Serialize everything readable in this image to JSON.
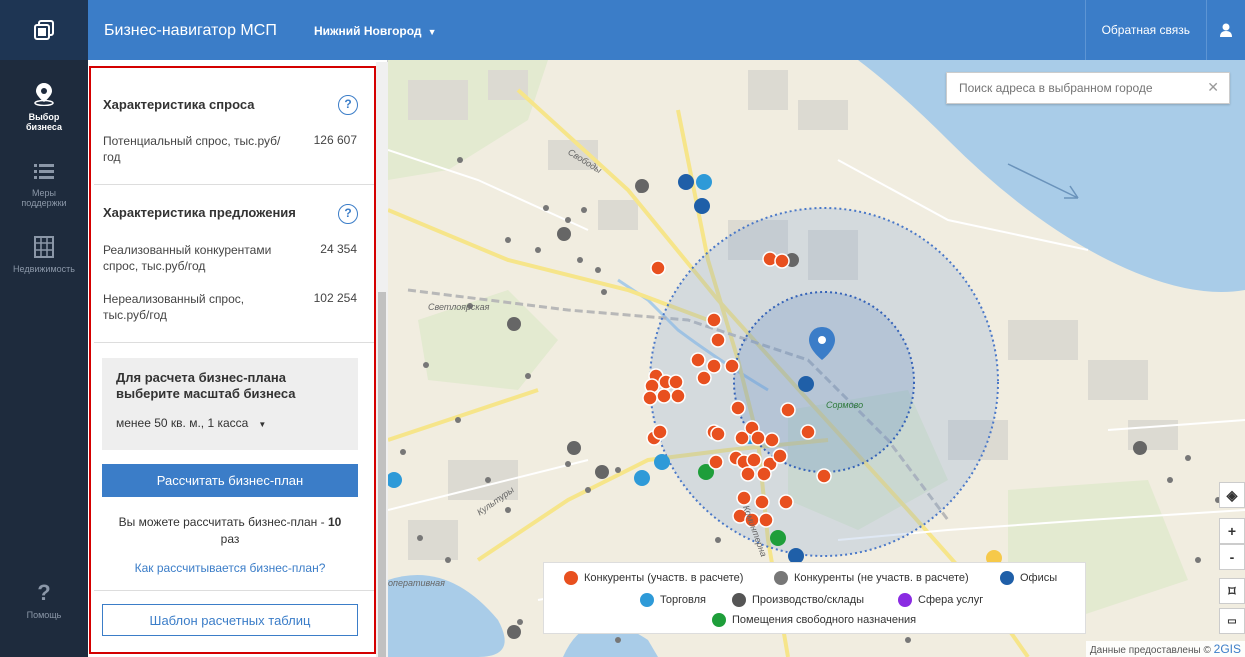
{
  "header": {
    "app_title": "Бизнес-навигатор МСП",
    "city": "Нижний Новгород",
    "feedback": "Обратная связь"
  },
  "sidenav": {
    "items": [
      {
        "label_line1": "Выбор",
        "label_line2": "бизнеса",
        "icon": "map-pin-icon"
      },
      {
        "label_line1": "Меры",
        "label_line2": "поддержки",
        "icon": "list-icon"
      },
      {
        "label_line1": "Недвижимость",
        "label_line2": "",
        "icon": "building-icon"
      },
      {
        "label_line1": "Помощь",
        "label_line2": "",
        "icon": "question-icon"
      }
    ]
  },
  "panel": {
    "demand": {
      "title": "Характеристика спроса",
      "rows": [
        {
          "label": "Потенциальный спрос, тыс.руб/год",
          "value": "126 607"
        }
      ]
    },
    "supply": {
      "title": "Характеристика предложения",
      "rows": [
        {
          "label": "Реализованный конкурентами спрос, тыс.руб/год",
          "value": "24 354"
        },
        {
          "label": "Нереализованный спрос, тыс.руб/год",
          "value": "102 254"
        }
      ]
    },
    "scale": {
      "title": "Для расчета бизнес-плана выберите масштаб бизнеса",
      "selected": "менее 50 кв. м., 1 касса"
    },
    "calc_button": "Рассчитать бизнес-план",
    "calc_note_prefix": "Вы можете рассчитать бизнес-план - ",
    "calc_note_count": "10",
    "calc_note_suffix": "раз",
    "how_link": "Как рассчитывается бизнес-план?",
    "template_button": "Шаблон расчетных таблиц"
  },
  "map": {
    "search_placeholder": "Поиск адреса в выбранном городе",
    "streets": [
      "Свободы",
      "Светлоярская",
      "Сормово",
      "Культуры",
      "Коминтерна",
      "оперативная"
    ],
    "attribution": "Данные предоставлены ©",
    "attribution_brand": "2GIS",
    "legend": [
      {
        "label": "Конкуренты (участв. в расчете)",
        "color": "#e8501f"
      },
      {
        "label": "Конкуренты (не участв. в расчете)",
        "color": "#777777"
      },
      {
        "label": "Офисы",
        "color": "#1f5fa8"
      },
      {
        "label": "Торговля",
        "color": "#2e9ad8"
      },
      {
        "label": "Производство/склады",
        "color": "#555555"
      },
      {
        "label": "Сфера услуг",
        "color": "#8a2be2"
      },
      {
        "label": "Помещения свободного назначения",
        "color": "#1e9e3a"
      }
    ]
  },
  "colors": {
    "header": "#3b7dc8",
    "sidenav": "#1e2b3d",
    "accent": "#3b7dc8",
    "frame": "#d40000"
  }
}
